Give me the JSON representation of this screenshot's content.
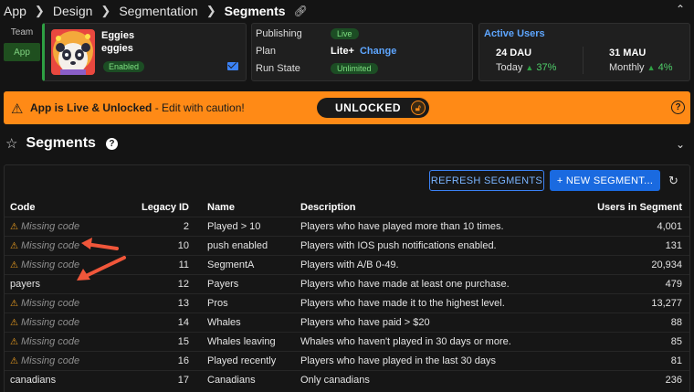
{
  "breadcrumb": {
    "items": [
      "App",
      "Design",
      "Segmentation",
      "Segments"
    ],
    "icon": "link-icon"
  },
  "team": {
    "label": "Team",
    "app_button": "App"
  },
  "app_card": {
    "name_line1": "Eggies",
    "name_line2": "eggies",
    "status": "Enabled",
    "icon": "mail-icon"
  },
  "plan_card": {
    "publishing_label": "Publishing",
    "publishing_value": "Live",
    "plan_label": "Plan",
    "plan_value": "Lite+",
    "plan_change": "Change",
    "run_state_label": "Run State",
    "run_state_value": "Unlimited"
  },
  "users_card": {
    "title": "Active Users",
    "dau": "24 DAU",
    "dau_period": "Today",
    "dau_change": "37%",
    "mau": "31 MAU",
    "mau_period": "Monthly",
    "mau_change": "4%"
  },
  "banner": {
    "title": "App is Live & Unlocked",
    "message": " - Edit with caution!",
    "toggle_label": "UNLOCKED"
  },
  "section": {
    "title": "Segments"
  },
  "toolbar": {
    "refresh_label": "REFRESH SEGMENTS",
    "new_label": "+ NEW SEGMENT..."
  },
  "table": {
    "headers": [
      "Code",
      "Legacy ID",
      "Name",
      "Description",
      "Users in Segment"
    ],
    "rows": [
      {
        "code": "Missing code",
        "missing": true,
        "id": "2",
        "name": "Played > 10",
        "desc": "Players who have played more than 10 times.",
        "users": "4,001"
      },
      {
        "code": "Missing code",
        "missing": true,
        "id": "10",
        "name": "push enabled",
        "desc": "Players with IOS push notifications enabled.",
        "users": "131"
      },
      {
        "code": "Missing code",
        "missing": true,
        "id": "11",
        "name": "SegmentA",
        "desc": "Players with A/B 0-49.",
        "users": "20,934"
      },
      {
        "code": "payers",
        "missing": false,
        "id": "12",
        "name": "Payers",
        "desc": "Players who have made at least one purchase.",
        "users": "479"
      },
      {
        "code": "Missing code",
        "missing": true,
        "id": "13",
        "name": "Pros",
        "desc": "Players who have made it to the highest level.",
        "users": "13,277"
      },
      {
        "code": "Missing code",
        "missing": true,
        "id": "14",
        "name": "Whales",
        "desc": "Players who have paid > $20",
        "users": "88"
      },
      {
        "code": "Missing code",
        "missing": true,
        "id": "15",
        "name": "Whales leaving",
        "desc": "Whales who haven't played in 30 days or more.",
        "users": "85"
      },
      {
        "code": "Missing code",
        "missing": true,
        "id": "16",
        "name": "Played recently",
        "desc": "Players who have played in the last 30 days",
        "users": "81"
      },
      {
        "code": "canadians",
        "missing": false,
        "id": "17",
        "name": "Canadians",
        "desc": "Only canadians",
        "users": "236"
      }
    ]
  },
  "colors": {
    "accent": "#1a6ae0",
    "warning": "#ff8a16",
    "live": "#2ea043",
    "annotation": "#f0563a"
  }
}
